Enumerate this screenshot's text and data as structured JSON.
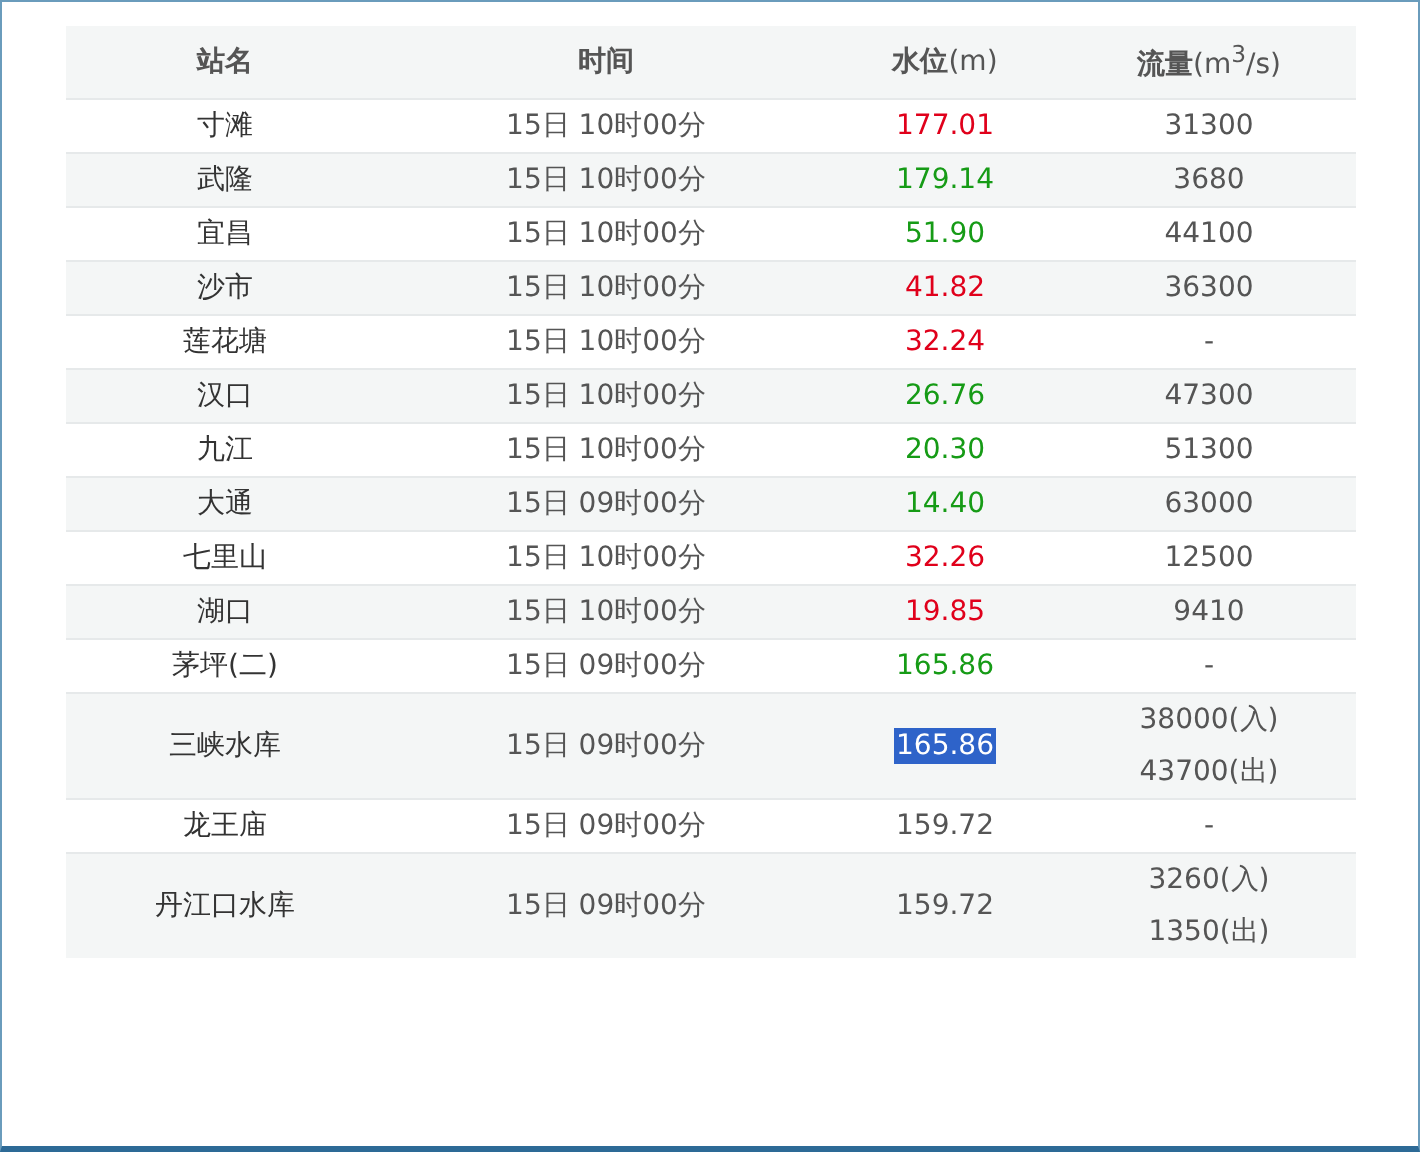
{
  "table": {
    "columns": [
      "**站名**",
      "**时间**",
      "**水位**(m)",
      "**流量**(m$^{3}$/s)"
    ],
    "rows": [
      {
        "station": "寸滩",
        "time": "15日 10时00分",
        "level_text": "177.01",
        "color": "#e0001b",
        "selected": false,
        "flow": [
          "31300"
        ]
      },
      {
        "station": "武隆",
        "time": "15日 10时00分",
        "level_text": "179.14",
        "color": "#169b16",
        "selected": false,
        "flow": [
          "3680"
        ]
      },
      {
        "station": "宜昌",
        "time": "15日 10时00分",
        "level_text": "51.90",
        "color": "#169b16",
        "selected": false,
        "flow": [
          "44100"
        ]
      },
      {
        "station": "沙市",
        "time": "15日 10时00分",
        "level_text": "41.82",
        "color": "#e0001b",
        "selected": false,
        "flow": [
          "36300"
        ]
      },
      {
        "station": "莲花塘",
        "time": "15日 10时00分",
        "level_text": "32.24",
        "color": "#e0001b",
        "selected": false,
        "flow": [
          "-"
        ]
      },
      {
        "station": "汉口",
        "time": "15日 10时00分",
        "level_text": "26.76",
        "color": "#169b16",
        "selected": false,
        "flow": [
          "47300"
        ]
      },
      {
        "station": "九江",
        "time": "15日 10时00分",
        "level_text": "20.30",
        "color": "#169b16",
        "selected": false,
        "flow": [
          "51300"
        ]
      },
      {
        "station": "大通",
        "time": "15日 09时00分",
        "level_text": "14.40",
        "color": "#169b16",
        "selected": false,
        "flow": [
          "63000"
        ]
      },
      {
        "station": "七里山",
        "time": "15日 10时00分",
        "level_text": "32.26",
        "color": "#e0001b",
        "selected": false,
        "flow": [
          "12500"
        ]
      },
      {
        "station": "湖口",
        "time": "15日 10时00分",
        "level_text": "19.85",
        "color": "#e0001b",
        "selected": false,
        "flow": [
          "9410"
        ]
      },
      {
        "station": "茅坪(二)",
        "time": "15日 09时00分",
        "level_text": "165.86",
        "color": "#169b16",
        "selected": false,
        "flow": [
          "-"
        ]
      },
      {
        "station": "三峡水库",
        "time": "15日 09时00分",
        "level_text": "165.86",
        "selected": true,
        "flow": [
          "38000(入)",
          "43700(出)"
        ]
      },
      {
        "station": "龙王庙",
        "time": "15日 09时00分",
        "level_text": "159.72",
        "color": "#555555",
        "selected": false,
        "flow": [
          "-"
        ]
      },
      {
        "station": "丹江口水库",
        "time": "15日 09时00分",
        "level_text": "159.72",
        "color": "#555555",
        "selected": false,
        "flow": [
          "3260(入)",
          "1350(出)"
        ]
      }
    ]
  }
}
